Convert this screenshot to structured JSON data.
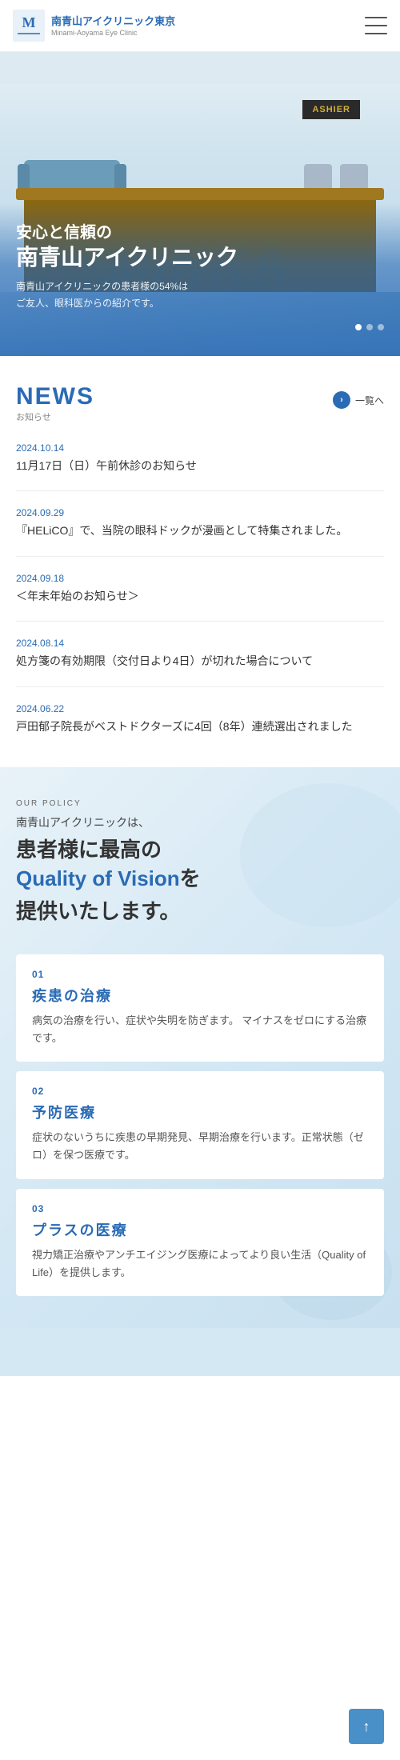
{
  "header": {
    "logo_text": "南青山アイクリニック東京",
    "logo_sub": "Minami-Aoyama\nEye Clinic",
    "menu_label": "メニュー"
  },
  "hero": {
    "sign_text": "ASHIER",
    "watermark": "MINKA",
    "title_line1": "安心と信頼の",
    "title_line2": "南青山アイクリニック",
    "subtitle_line1": "南青山アイクリニックの患者様の54%は",
    "subtitle_line2": "ご友人、眼科医からの紹介です。",
    "dots": [
      {
        "active": true
      },
      {
        "active": false
      },
      {
        "active": false
      }
    ]
  },
  "news": {
    "section_title": "NEWS",
    "section_sub": "お知らせ",
    "more_text": "一覧へ",
    "items": [
      {
        "date": "2024.10.14",
        "text": "11月17日（日）午前休診のお知らせ"
      },
      {
        "date": "2024.09.29",
        "text": "『HELiCO』で、当院の眼科ドックが漫画として特集されました。"
      },
      {
        "date": "2024.09.18",
        "text": "＜年末年始のお知らせ＞"
      },
      {
        "date": "2024.08.14",
        "text": "処方箋の有効期限（交付日より4日）が切れた場合について"
      },
      {
        "date": "2024.06.22",
        "text": "戸田郁子院長がベストドクターズに4回（8年）連続選出されました"
      }
    ]
  },
  "policy": {
    "label": "OUR POLICY",
    "intro": "南青山アイクリニックは、",
    "heading_part1": "患者様に最高の",
    "heading_quality": "Quality of Vision",
    "heading_part2": "を",
    "heading_part3": "提供いたします。",
    "services": [
      {
        "number": "01",
        "title": "疾患の治療",
        "desc": "病気の治療を行い、症状や失明を防ぎます。\nマイナスをゼロにする治療です。"
      },
      {
        "number": "02",
        "title": "予防医療",
        "desc": "症状のないうちに疾患の早期発見、早期治療を行います。正常状態（ゼロ）を保つ医療です。"
      },
      {
        "number": "03",
        "title": "プラスの医療",
        "desc": "視力矯正治療やアンチエイジング医療によってより良い生活（Quality of Life）を提供します。"
      }
    ]
  },
  "scroll_top": {
    "label": "↑"
  }
}
